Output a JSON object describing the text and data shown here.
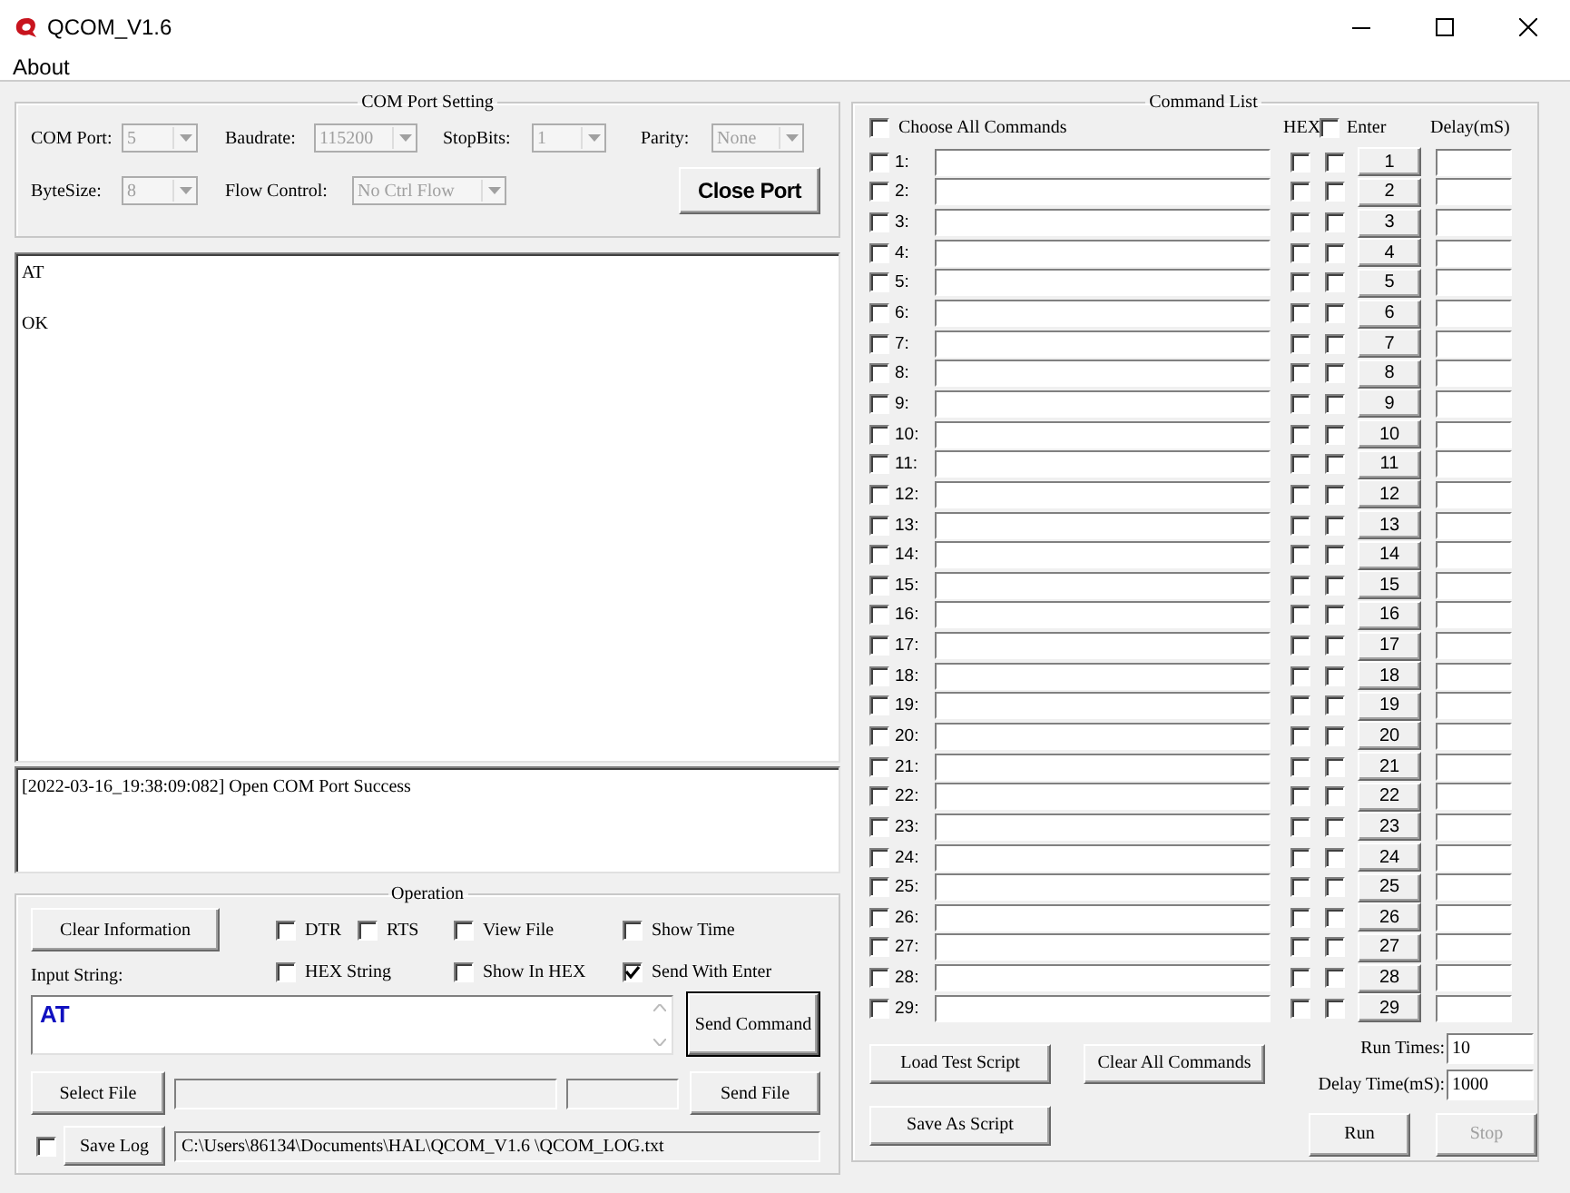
{
  "window": {
    "title": "QCOM_V1.6"
  },
  "menu": [
    {
      "label": "About"
    }
  ],
  "com_port_setting": {
    "title": "COM Port Setting",
    "fields": [
      {
        "label": "COM Port:",
        "value": "5",
        "disabled": true
      },
      {
        "label": "Baudrate:",
        "value": "115200",
        "disabled": true
      },
      {
        "label": "StopBits:",
        "value": "1",
        "disabled": true
      },
      {
        "label": "Parity:",
        "value": "None",
        "disabled": true
      },
      {
        "label": "ByteSize:",
        "value": "8",
        "disabled": true
      },
      {
        "label": "Flow Control:",
        "value": "No Ctrl Flow",
        "disabled": true
      }
    ],
    "button": "Close Port"
  },
  "receive_text": [
    "AT",
    "OK"
  ],
  "log_text": [
    "[2022-03-16_19:38:09:082] Open COM Port Success"
  ],
  "operation": {
    "title": "Operation",
    "clear_button": "Clear Information",
    "checkboxes": [
      {
        "label": "DTR",
        "checked": false
      },
      {
        "label": "RTS",
        "checked": false
      },
      {
        "label": "View File",
        "checked": false
      },
      {
        "label": "Show Time",
        "checked": false
      },
      {
        "label": "HEX String",
        "checked": false
      },
      {
        "label": "Show In HEX",
        "checked": false
      },
      {
        "label": "Send With Enter",
        "checked": true
      }
    ],
    "input_label": "Input String:",
    "input_value": "AT",
    "send_button": "Send Command",
    "select_file_button": "Select File",
    "send_file_button": "Send File",
    "save_log": {
      "checked": false,
      "label": "Save Log"
    },
    "log_path": "C:\\Users\\86134\\Documents\\HAL\\QCOM_V1.6 \\QCOM_LOG.txt"
  },
  "command_list": {
    "title": "Command List",
    "choose_all": {
      "label": "Choose All Commands",
      "checked": false
    },
    "hex_label": "HEX",
    "enter": {
      "label": "Enter",
      "checked": false
    },
    "delay_label": "Delay(mS)",
    "rows": [
      {
        "label": "1:",
        "checked": false,
        "hex": false,
        "enter": false,
        "button": "1"
      },
      {
        "label": "2:",
        "checked": false,
        "hex": false,
        "enter": false,
        "button": "2"
      },
      {
        "label": "3:",
        "checked": false,
        "hex": false,
        "enter": false,
        "button": "3"
      },
      {
        "label": "4:",
        "checked": false,
        "hex": false,
        "enter": false,
        "button": "4"
      },
      {
        "label": "5:",
        "checked": false,
        "hex": false,
        "enter": false,
        "button": "5"
      },
      {
        "label": "6:",
        "checked": false,
        "hex": false,
        "enter": false,
        "button": "6"
      },
      {
        "label": "7:",
        "checked": false,
        "hex": false,
        "enter": false,
        "button": "7"
      },
      {
        "label": "8:",
        "checked": false,
        "hex": false,
        "enter": false,
        "button": "8"
      },
      {
        "label": "9:",
        "checked": false,
        "hex": false,
        "enter": false,
        "button": "9"
      },
      {
        "label": "10:",
        "checked": false,
        "hex": false,
        "enter": false,
        "button": "10"
      },
      {
        "label": "11:",
        "checked": false,
        "hex": false,
        "enter": false,
        "button": "11"
      },
      {
        "label": "12:",
        "checked": false,
        "hex": false,
        "enter": false,
        "button": "12"
      },
      {
        "label": "13:",
        "checked": false,
        "hex": false,
        "enter": false,
        "button": "13"
      },
      {
        "label": "14:",
        "checked": false,
        "hex": false,
        "enter": false,
        "button": "14"
      },
      {
        "label": "15:",
        "checked": false,
        "hex": false,
        "enter": false,
        "button": "15"
      },
      {
        "label": "16:",
        "checked": false,
        "hex": false,
        "enter": false,
        "button": "16"
      },
      {
        "label": "17:",
        "checked": false,
        "hex": false,
        "enter": false,
        "button": "17"
      },
      {
        "label": "18:",
        "checked": false,
        "hex": false,
        "enter": false,
        "button": "18"
      },
      {
        "label": "19:",
        "checked": false,
        "hex": false,
        "enter": false,
        "button": "19"
      },
      {
        "label": "20:",
        "checked": false,
        "hex": false,
        "enter": false,
        "button": "20"
      },
      {
        "label": "21:",
        "checked": false,
        "hex": false,
        "enter": false,
        "button": "21"
      },
      {
        "label": "22:",
        "checked": false,
        "hex": false,
        "enter": false,
        "button": "22"
      },
      {
        "label": "23:",
        "checked": false,
        "hex": false,
        "enter": false,
        "button": "23"
      },
      {
        "label": "24:",
        "checked": false,
        "hex": false,
        "enter": false,
        "button": "24"
      },
      {
        "label": "25:",
        "checked": false,
        "hex": false,
        "enter": false,
        "button": "25"
      },
      {
        "label": "26:",
        "checked": false,
        "hex": false,
        "enter": false,
        "button": "26"
      },
      {
        "label": "27:",
        "checked": false,
        "hex": false,
        "enter": false,
        "button": "27"
      },
      {
        "label": "28:",
        "checked": false,
        "hex": false,
        "enter": false,
        "button": "28"
      },
      {
        "label": "29:",
        "checked": false,
        "hex": false,
        "enter": false,
        "button": "29"
      }
    ],
    "load_button": "Load Test Script",
    "clear_button": "Clear All Commands",
    "save_button": "Save As Script",
    "run_times_label": "Run Times:",
    "run_times": "10",
    "delay_time_label": "Delay Time(mS):",
    "delay_time": "1000",
    "run_button": {
      "label": "Run",
      "disabled": false
    },
    "stop_button": {
      "label": "Stop",
      "disabled": true
    }
  }
}
